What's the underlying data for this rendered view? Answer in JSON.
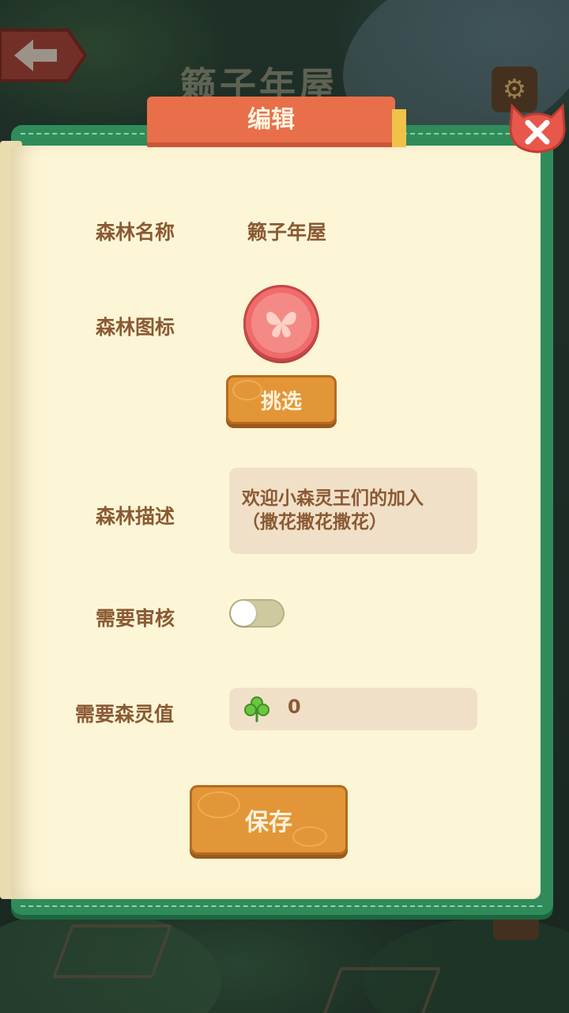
{
  "background": {
    "title": "籁子年屋"
  },
  "dialog": {
    "title": "编辑"
  },
  "form": {
    "forest_name_label": "森林名称",
    "forest_name_value": "籁子年屋",
    "forest_icon_label": "森林图标",
    "choose_button_label": "挑选",
    "forest_desc_label": "森林描述",
    "forest_desc_line1": "欢迎小森灵王们的加入",
    "forest_desc_line2": "（撒花撒花撒花）",
    "require_review_label": "需要审核",
    "require_review_enabled": false,
    "require_spirit_label": "需要森灵值",
    "require_spirit_value": "0",
    "save_button_label": "保存"
  },
  "icons": {
    "back": "arrow-left-icon",
    "settings": "gear-icon",
    "close": "close-icon",
    "forest_icon": "butterfly-icon",
    "spirit": "clover-icon"
  },
  "colors": {
    "accent_red": "#e86f49",
    "book_green": "#2f8c5a",
    "page_cream": "#fdf6d6",
    "wood_orange": "#e39638",
    "text_brown": "#8a5a34"
  }
}
